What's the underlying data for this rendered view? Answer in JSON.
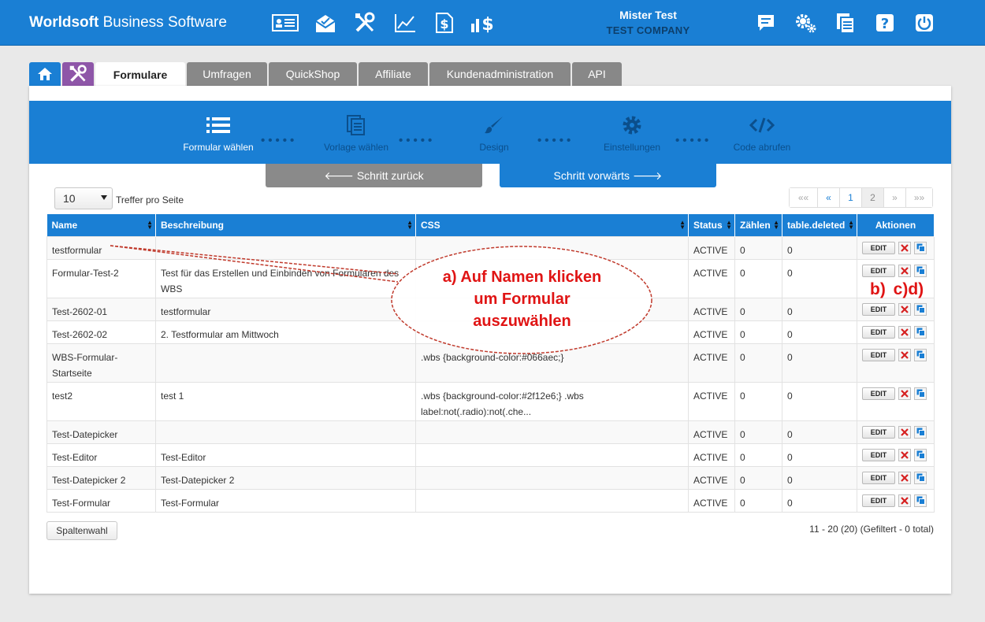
{
  "header": {
    "brand_bold": "Worldsoft",
    "brand_rest": " Business Software",
    "user_name": "Mister Test",
    "company": "TEST COMPANY",
    "left_icons": [
      "contact-card-icon",
      "mail-icon",
      "tools-icon",
      "chart-icon",
      "dollar-document-icon",
      "bar-dollar-icon"
    ],
    "right_icons": [
      "comment-icon",
      "settings-icon",
      "documents-icon",
      "help-icon",
      "power-icon"
    ]
  },
  "tabs": [
    {
      "label": "Formulare"
    },
    {
      "label": "Umfragen"
    },
    {
      "label": "QuickShop"
    },
    {
      "label": "Affiliate"
    },
    {
      "label": "Kundenadministration"
    },
    {
      "label": "API"
    }
  ],
  "wizard": {
    "steps": [
      {
        "label": "Formular wählen",
        "icon": "list-icon"
      },
      {
        "label": "Vorlage wählen",
        "icon": "document-copy-icon"
      },
      {
        "label": "Design",
        "icon": "brush-icon"
      },
      {
        "label": "Einstellungen",
        "icon": "gear-icon"
      },
      {
        "label": "Code abrufen",
        "icon": "code-icon"
      }
    ],
    "back_label": "Schritt zurück",
    "forward_label": "Schritt vorwärts"
  },
  "list": {
    "per_page": "10",
    "per_page_label": "Treffer pro Seite",
    "pager": [
      "««",
      "«",
      "1",
      "2",
      "»",
      "»»"
    ],
    "columns": [
      "Name",
      "Beschreibung",
      "CSS",
      "Status",
      "Zählen",
      "table.deleted",
      "Aktionen"
    ],
    "edit_label": "EDIT",
    "rows": [
      {
        "name": "testformular",
        "desc": "",
        "css": "",
        "status": "ACTIVE",
        "count": "0",
        "deleted": "0"
      },
      {
        "name": "Formular-Test-2",
        "desc": "Test für das Erstellen und Einbinden von Formularen des WBS",
        "css": "",
        "status": "ACTIVE",
        "count": "0",
        "deleted": "0"
      },
      {
        "name": "Test-2602-01",
        "desc": "testformular",
        "css": "",
        "status": "ACTIVE",
        "count": "0",
        "deleted": "0"
      },
      {
        "name": "Test-2602-02",
        "desc": "2. Testformular am Mittwoch",
        "css": "",
        "status": "ACTIVE",
        "count": "0",
        "deleted": "0"
      },
      {
        "name": "WBS-Formular-Startseite",
        "desc": "",
        "css": ".wbs {background-color:#066aec;}",
        "status": "ACTIVE",
        "count": "0",
        "deleted": "0"
      },
      {
        "name": "test2",
        "desc": "test 1",
        "css": ".wbs {background-color:#2f12e6;} .wbs label:not(.radio):not(.che...",
        "status": "ACTIVE",
        "count": "0",
        "deleted": "0"
      },
      {
        "name": "Test-Datepicker",
        "desc": "",
        "css": "",
        "status": "ACTIVE",
        "count": "0",
        "deleted": "0"
      },
      {
        "name": "Test-Editor",
        "desc": "Test-Editor",
        "css": "",
        "status": "ACTIVE",
        "count": "0",
        "deleted": "0"
      },
      {
        "name": "Test-Datepicker 2",
        "desc": "Test-Datepicker 2",
        "css": "",
        "status": "ACTIVE",
        "count": "0",
        "deleted": "0"
      },
      {
        "name": "Test-Formular",
        "desc": "Test-Formular",
        "css": "",
        "status": "ACTIVE",
        "count": "0",
        "deleted": "0"
      }
    ],
    "column_select_label": "Spaltenwahl",
    "total_text": "11 - 20 (20) (Gefiltert - 0 total)"
  },
  "annotation": {
    "callout_lines": [
      "a) Auf Namen klicken",
      "um Formular",
      "auszuwählen"
    ],
    "actions_hint": "b) c)d)"
  },
  "colors": {
    "primary": "#1a7fd4",
    "tools_tab": "#8e56a8",
    "annotation": "#e01414"
  }
}
